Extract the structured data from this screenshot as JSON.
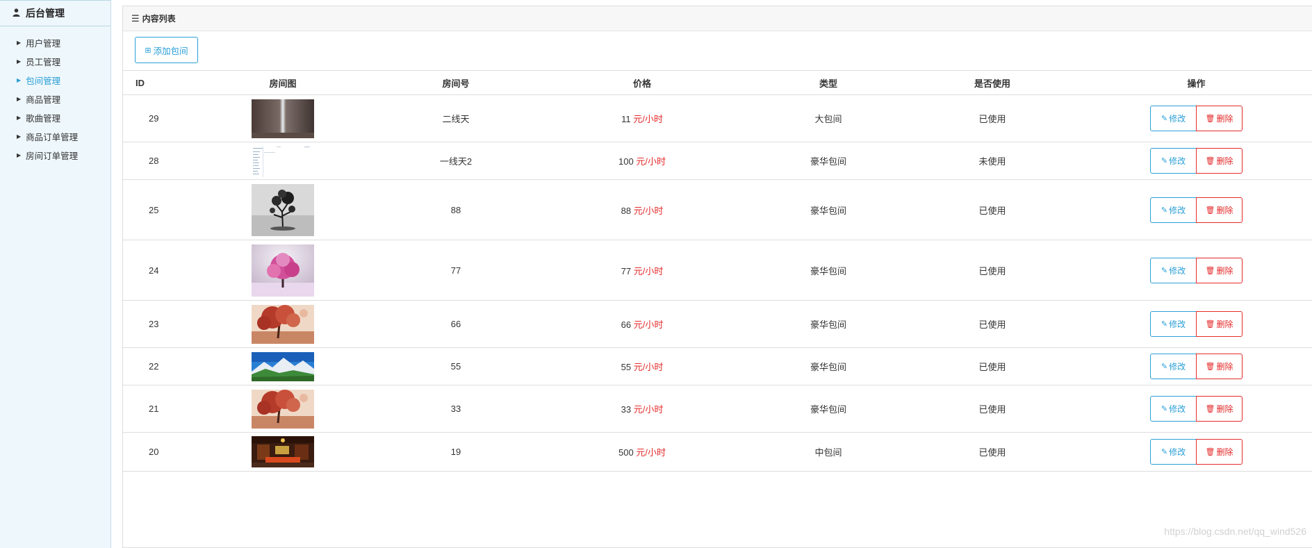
{
  "sidebar": {
    "title": "后台管理",
    "items": [
      {
        "label": "用户管理",
        "active": false
      },
      {
        "label": "员工管理",
        "active": false
      },
      {
        "label": "包间管理",
        "active": true
      },
      {
        "label": "商品管理",
        "active": false
      },
      {
        "label": "歌曲管理",
        "active": false
      },
      {
        "label": "商品订单管理",
        "active": false
      },
      {
        "label": "房间订单管理",
        "active": false
      }
    ]
  },
  "panel": {
    "title": "内容列表",
    "add_button": "添加包间"
  },
  "table": {
    "headers": [
      "ID",
      "房间图",
      "房间号",
      "价格",
      "类型",
      "是否使用",
      "操作"
    ],
    "price_unit": "元/小时",
    "edit_label": "修改",
    "delete_label": "删除",
    "rows": [
      {
        "id": "29",
        "room_no": "二线天",
        "price": "11",
        "type": "大包间",
        "used": "已使用",
        "image": "rock-crevice"
      },
      {
        "id": "28",
        "room_no": "一线天2",
        "price": "100",
        "type": "豪华包间",
        "used": "未使用",
        "image": "screenshot"
      },
      {
        "id": "25",
        "room_no": "88",
        "price": "88",
        "type": "豪华包间",
        "used": "已使用",
        "image": "bw-tree"
      },
      {
        "id": "24",
        "room_no": "77",
        "price": "77",
        "type": "豪华包间",
        "used": "已使用",
        "image": "pink-tree"
      },
      {
        "id": "23",
        "room_no": "66",
        "price": "66",
        "type": "豪华包间",
        "used": "已使用",
        "image": "red-tree"
      },
      {
        "id": "22",
        "room_no": "55",
        "price": "55",
        "type": "豪华包间",
        "used": "已使用",
        "image": "mountain"
      },
      {
        "id": "21",
        "room_no": "33",
        "price": "33",
        "type": "豪华包间",
        "used": "已使用",
        "image": "red-tree"
      },
      {
        "id": "20",
        "room_no": "19",
        "price": "500",
        "type": "中包间",
        "used": "已使用",
        "image": "interior"
      }
    ]
  },
  "watermark": "https://blog.csdn.net/qq_wind526",
  "colors": {
    "primary": "#2a9fd6",
    "danger": "#e52a2a"
  }
}
